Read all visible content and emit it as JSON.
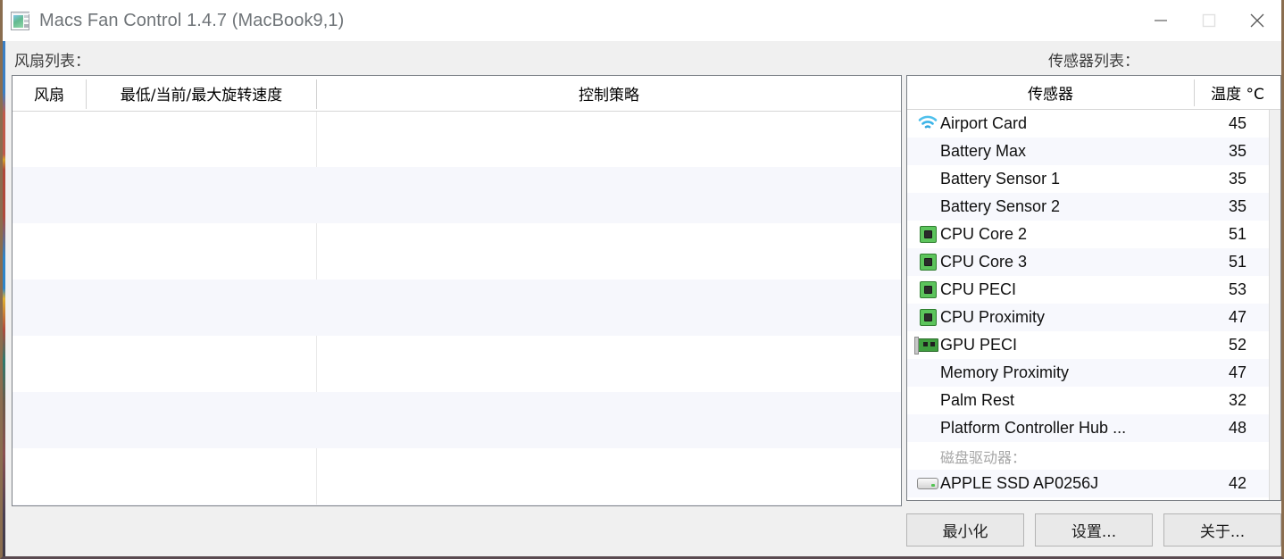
{
  "window": {
    "title": "Macs Fan Control 1.4.7 (MacBook9,1)",
    "app_icon": "app-window-icon",
    "controls": {
      "minimize": "minimize-icon",
      "maximize": "maximize-icon",
      "close": "close-icon"
    },
    "border_color": "#8a6d4f",
    "background_color": "#f0f0f0"
  },
  "fan_panel": {
    "label": "风扇列表：",
    "columns": [
      "风扇",
      "最低/当前/最大旋转速度",
      "控制策略"
    ],
    "rows": []
  },
  "sensor_panel": {
    "label": "传感器列表：",
    "columns": [
      "传感器",
      "温度 °C"
    ],
    "rows": [
      {
        "icon": "wifi-icon",
        "name": "Airport Card",
        "value": "45"
      },
      {
        "icon": "",
        "name": "Battery Max",
        "value": "35"
      },
      {
        "icon": "",
        "name": "Battery Sensor 1",
        "value": "35"
      },
      {
        "icon": "",
        "name": "Battery Sensor 2",
        "value": "35"
      },
      {
        "icon": "cpu-icon",
        "name": "CPU Core 2",
        "value": "51"
      },
      {
        "icon": "cpu-icon",
        "name": "CPU Core 3",
        "value": "51"
      },
      {
        "icon": "cpu-icon",
        "name": "CPU PECI",
        "value": "53"
      },
      {
        "icon": "cpu-icon",
        "name": "CPU Proximity",
        "value": "47"
      },
      {
        "icon": "gpu-icon",
        "name": "GPU PECI",
        "value": "52"
      },
      {
        "icon": "",
        "name": "Memory Proximity",
        "value": "47"
      },
      {
        "icon": "",
        "name": "Palm Rest",
        "value": "32"
      },
      {
        "icon": "",
        "name": "Platform Controller Hub ...",
        "value": "48"
      },
      {
        "icon": "",
        "name": "磁盘驱动器：",
        "value": "",
        "group": true
      },
      {
        "icon": "disk-icon",
        "name": "APPLE SSD AP0256J",
        "value": "42"
      }
    ],
    "stripe_color": "#f7f8fd",
    "accent_wifi_color": "#3cb4e8"
  },
  "buttons": {
    "minimize": "最小化",
    "settings": "设置...",
    "about": "关于..."
  }
}
